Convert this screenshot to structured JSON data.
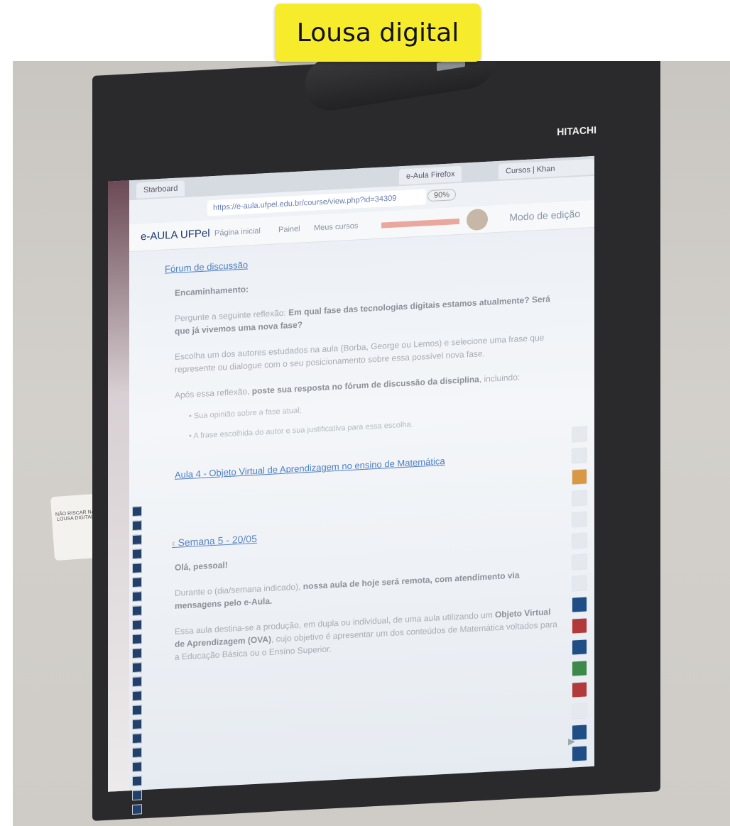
{
  "caption": "Lousa digital",
  "board": {
    "brand": "HITACHI",
    "sticker_text": "NÃO RISCAR NA LOUSA DIGITAL"
  },
  "browser": {
    "app": "Starboard",
    "window_title": "e-Aula Firefox",
    "tab_other": "Cursos | Khan Academy",
    "url": "https://e-aula.ufpel.edu.br/course/view.php?id=34309",
    "zoom": "90%"
  },
  "site": {
    "brand": "e-AULA UFPel",
    "menu": [
      "Página inicial",
      "Painel",
      "Meus cursos"
    ],
    "edit_mode": "Modo de edição"
  },
  "content": {
    "forum_link": "Fórum de discussão",
    "heading": "Encaminhamento:",
    "p1_pre": "Pergunte a seguinte reflexão:",
    "p1_bold": "Em qual fase das tecnologias digitais estamos atualmente? Será que já vivemos uma nova fase?",
    "p2": "Escolha um dos autores estudados na aula (Borba, George ou Lemos) e selecione uma frase que represente ou dialogue com o seu posicionamento sobre essa possível nova fase.",
    "p3_pre": "Após essa reflexão,",
    "p3_bold": "poste sua resposta no fórum de discussão da disciplina",
    "p3_post": ", incluindo:",
    "bullets": [
      "Sua opinião sobre a fase atual;",
      "A frase escolhida do autor e sua justificativa para essa escolha."
    ],
    "aula_link": "Aula 4 - Objeto Virtual de Aprendizagem no ensino de Matemática",
    "section_title": "Semana 5 - 20/05",
    "greeting": "Olá, pessoal!",
    "p4_pre": "Durante o (dia/semana indicado),",
    "p4_bold": "nossa aula de hoje será remota, com atendimento via mensagens pelo e-Aula.",
    "p5_pre": "Essa aula destina-se a produção, em dupla ou individual, de uma aula utilizando um",
    "p5_bold": "Objeto Virtual de Aprendizagem (OVA)",
    "p5_post": ", cujo objetivo é apresentar um dos conteúdos de Matemática voltados para a Educação Básica ou o Ensino Superior."
  }
}
